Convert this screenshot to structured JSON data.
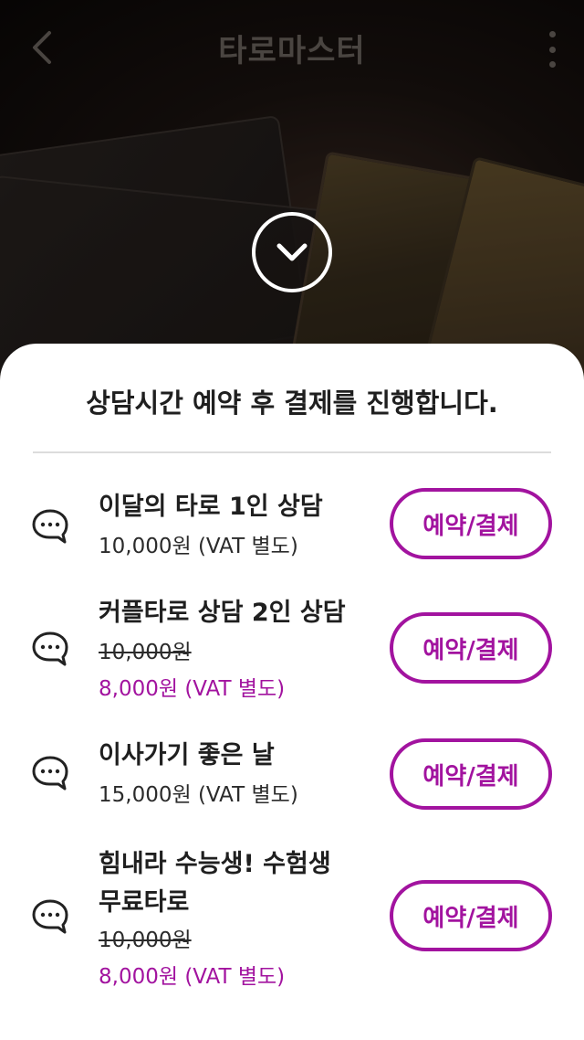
{
  "header": {
    "title": "타로마스터"
  },
  "sheet": {
    "title": "상담시간 예약 후 결제를 진행합니다."
  },
  "items": [
    {
      "name": "이달의 타로 1인 상담",
      "price": "10,000원 (VAT 별도)",
      "button": "예약/결제"
    },
    {
      "name": "커플타로 상담 2인 상담",
      "original_price": "10,000원",
      "price": "8,000원 (VAT 별도)",
      "button": "예약/결제"
    },
    {
      "name": "이사가기 좋은 날",
      "price": "15,000원 (VAT 별도)",
      "button": "예약/결제"
    },
    {
      "name_line1": "힘내라 수능생! 수험생",
      "name_line2": "무료타로",
      "original_price": "10,000원",
      "price": "8,000원 (VAT 별도)",
      "button": "예약/결제"
    }
  ],
  "icons": {
    "back": "chevron-left-icon",
    "more": "more-vertical-icon",
    "collapse": "chevron-down-circle-icon",
    "item": "chat-bubble-icon"
  },
  "colors": {
    "accent": "#a2139f",
    "text": "#1f1f1f"
  }
}
